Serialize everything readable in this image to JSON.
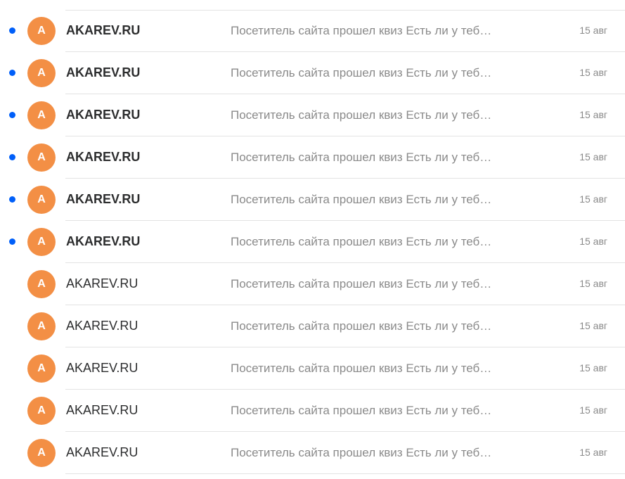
{
  "colors": {
    "unread_dot": "#005ff9",
    "avatar_background": "#f38f45",
    "sender_text": "#2c2d2e",
    "secondary_text": "#8a8a8a",
    "divider": "#e3e3e3"
  },
  "messages": [
    {
      "unread": true,
      "avatar_letter": "A",
      "sender": "AKAREV.RU",
      "snippet": "Посетитель сайта прошел квиз Есть ли у теб…",
      "date": "15 авг"
    },
    {
      "unread": true,
      "avatar_letter": "A",
      "sender": "AKAREV.RU",
      "snippet": "Посетитель сайта прошел квиз Есть ли у теб…",
      "date": "15 авг"
    },
    {
      "unread": true,
      "avatar_letter": "A",
      "sender": "AKAREV.RU",
      "snippet": "Посетитель сайта прошел квиз Есть ли у теб…",
      "date": "15 авг"
    },
    {
      "unread": true,
      "avatar_letter": "A",
      "sender": "AKAREV.RU",
      "snippet": "Посетитель сайта прошел квиз Есть ли у теб…",
      "date": "15 авг"
    },
    {
      "unread": true,
      "avatar_letter": "A",
      "sender": "AKAREV.RU",
      "snippet": "Посетитель сайта прошел квиз Есть ли у теб…",
      "date": "15 авг"
    },
    {
      "unread": true,
      "avatar_letter": "A",
      "sender": "AKAREV.RU",
      "snippet": "Посетитель сайта прошел квиз Есть ли у теб…",
      "date": "15 авг"
    },
    {
      "unread": false,
      "avatar_letter": "A",
      "sender": "AKAREV.RU",
      "snippet": "Посетитель сайта прошел квиз Есть ли у теб…",
      "date": "15 авг"
    },
    {
      "unread": false,
      "avatar_letter": "A",
      "sender": "AKAREV.RU",
      "snippet": "Посетитель сайта прошел квиз Есть ли у теб…",
      "date": "15 авг"
    },
    {
      "unread": false,
      "avatar_letter": "A",
      "sender": "AKAREV.RU",
      "snippet": "Посетитель сайта прошел квиз Есть ли у теб…",
      "date": "15 авг"
    },
    {
      "unread": false,
      "avatar_letter": "A",
      "sender": "AKAREV.RU",
      "snippet": "Посетитель сайта прошел квиз Есть ли у теб…",
      "date": "15 авг"
    },
    {
      "unread": false,
      "avatar_letter": "A",
      "sender": "AKAREV.RU",
      "snippet": "Посетитель сайта прошел квиз Есть ли у теб…",
      "date": "15 авг"
    }
  ]
}
